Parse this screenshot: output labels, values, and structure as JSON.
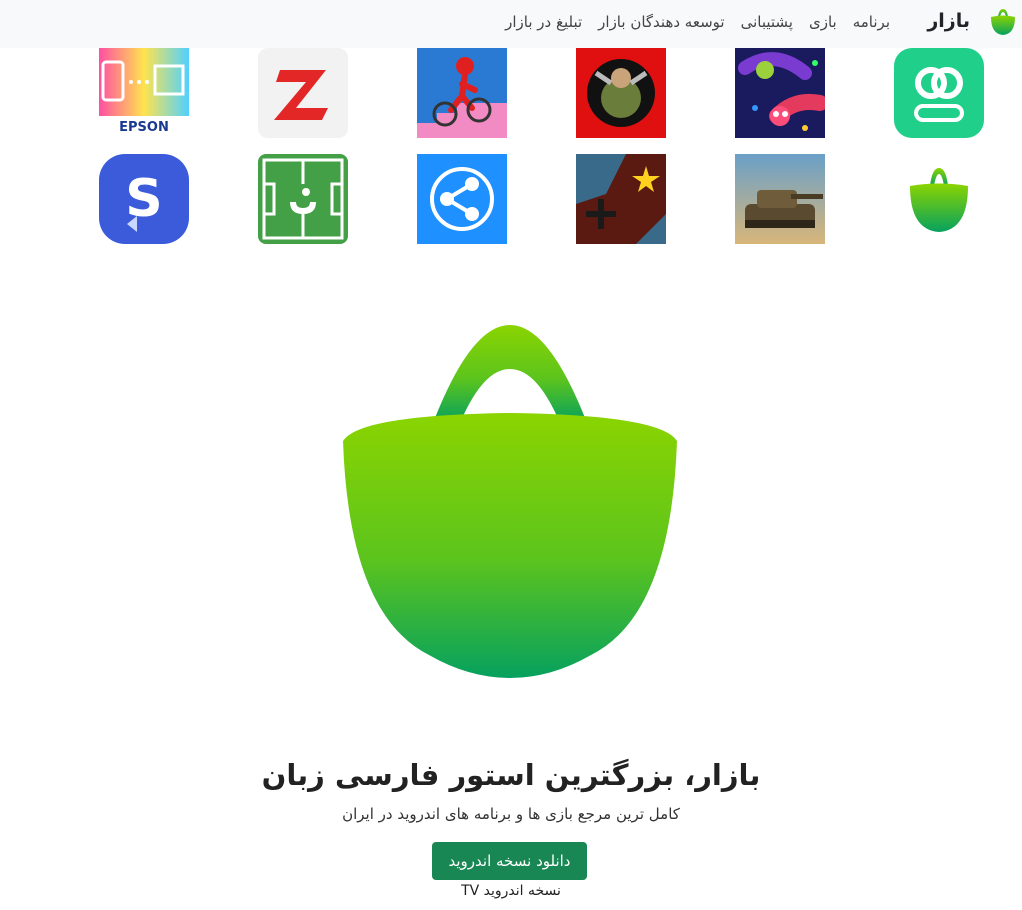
{
  "navbar": {
    "brand": {
      "name": "بازار",
      "logo_icon": "bazaar-bag-icon"
    },
    "links": [
      {
        "label": "برنامه"
      },
      {
        "label": "بازی"
      },
      {
        "label": "پشتیبانی"
      },
      {
        "label": "توسعه دهندگان بازار"
      },
      {
        "label": "تبلیغ در بازار"
      }
    ]
  },
  "apps": [
    {
      "icon": "pod-app-icon",
      "color": "#1fcf8a"
    },
    {
      "icon": "snake-game-icon",
      "color": "#1a1a5e"
    },
    {
      "icon": "fighter-game-icon",
      "color": "#e01010"
    },
    {
      "icon": "bmx-game-icon",
      "color": "#2a7ad4"
    },
    {
      "icon": "zapya-app-icon",
      "color": "#e32626",
      "text": "Z"
    },
    {
      "icon": "epson-print-app-icon",
      "color": "#1a3a8f",
      "text": "EPSON"
    },
    {
      "icon": "bazaar-bag-icon",
      "color": "#4cc23a"
    },
    {
      "icon": "tank-game-icon",
      "color": "#8a6a3a"
    },
    {
      "icon": "strategy-game-icon",
      "color": "#a01010"
    },
    {
      "icon": "shareit-app-icon",
      "color": "#1e90ff"
    },
    {
      "icon": "football-app-icon",
      "color": "#43a047"
    },
    {
      "icon": "smart-switch-app-icon",
      "color": "#3b5bdb",
      "text": "S"
    }
  ],
  "hero": {
    "logo_icon": "bazaar-bag-icon",
    "title": "بازار، بزرگترین استور فارسی زبان",
    "subtitle": "کامل ترین مرجع بازی ها و برنامه های اندروید در ایران",
    "download_label": "دانلود نسخه اندروید",
    "tv_label": "نسخه اندروید TV"
  },
  "colors": {
    "brand_green_top": "#8bd400",
    "brand_green_bottom": "#06a15e",
    "button": "#198754",
    "navbar_bg": "#f8f9fa"
  }
}
